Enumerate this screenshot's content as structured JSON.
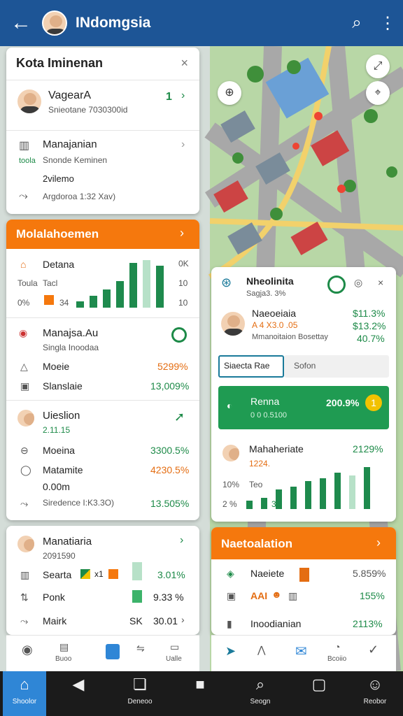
{
  "app": {
    "title": "INdomgsia",
    "back_icon": "arrow-left-icon",
    "search_icon": "search-icon",
    "more_icon": "more-vertical-icon"
  },
  "left_card": {
    "header": "Kota Iminenan",
    "close": "×",
    "item1": {
      "name": "VagearA",
      "sub": "Snieotane 7030300id",
      "value": "1"
    },
    "item2": {
      "name": "Manajanian",
      "tag": "toola",
      "sub": "Snonde Keminen",
      "line2": "2vilemo",
      "line3": "Argdoroa 1:32 Xav)"
    }
  },
  "stats_card": {
    "header": "Molalahoemen",
    "chart_labels": {
      "a": "Detana",
      "b": "Toula",
      "b2": "Tacl",
      "c": "0%",
      "c2": "34",
      "r1": "0K",
      "r2": "10",
      "r3": "10"
    },
    "chart_data": {
      "type": "bar",
      "values": [
        10,
        20,
        30,
        45,
        75,
        80,
        70
      ]
    },
    "section2": {
      "title": "Manajsa.Au",
      "sub": "Singla Inoodaa",
      "r1_label": "Moeie",
      "r1_val": "5299%",
      "r2_label": "Slanslaie",
      "r2_val": "13,009%"
    },
    "section3": {
      "title": "Uieslion",
      "sub": "2.11.15",
      "r1_label": "Moeina",
      "r1_val": "3300.5%",
      "r2_label": "Matamite",
      "r2_val": "4230.5%",
      "r2_sub": "0.00m",
      "r3_label": "Siredence I:K3.3O)",
      "r3_val": "13.505%"
    }
  },
  "bottom_left": {
    "title": "Manatiaria",
    "sub": "2091590",
    "r1_label": "Searta",
    "r1_x": "x1",
    "r1_val": "3.01%",
    "r2_label": "Ponk",
    "r2_val": "9.33 %",
    "r3_label": "Mairk",
    "r3_k": "SK",
    "r3_val": "30.01"
  },
  "right_panel": {
    "title": "Nheolinita",
    "sub": "Sagja3. 3%",
    "p1": {
      "name": "Naeoeiaia",
      "sub": "A 4 X3.0 .05",
      "sub2": "Mmanoitaion Bosettay",
      "v1": "$11.3%",
      "v2": "$13.2%",
      "v3": "40.7%"
    },
    "search_placeholder": "Siaecta Rae",
    "search_tab2": "Sofon",
    "green": {
      "title": "Renna",
      "sub": "0 0 0.5100",
      "val": "200.9%",
      "badge": "1"
    },
    "p2": {
      "name": "Mahaheriate",
      "sub": "1224.",
      "val": "2129%",
      "lbl1": "10%",
      "lbl2": "Teo",
      "lbl3": "2 %",
      "lbl4": "3"
    },
    "chart_data": {
      "type": "bar",
      "values": [
        15,
        20,
        35,
        40,
        50,
        55,
        65,
        60,
        75
      ]
    }
  },
  "right_bottom": {
    "header": "Naetoalation",
    "r1_label": "Naeiete",
    "r1_val": "5.859%",
    "r2_label": "AAI",
    "r2_val": "155%",
    "r3_label": "Inoodianian",
    "r3_val": "2113%"
  },
  "tabbar_left": {
    "t1": "Buoo",
    "t2": "Ualle"
  },
  "tabbar_right": {
    "t1": "Bcoiio"
  },
  "nav": {
    "home": "Shoolor",
    "recent": "Deneoo",
    "search": "Seogn",
    "profile": "Reobor"
  }
}
